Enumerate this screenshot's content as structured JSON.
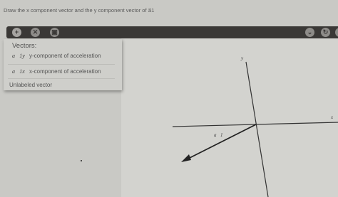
{
  "instruction": "Draw the x component vector and the y component vector of a⃗1",
  "toolbar": {
    "add_label": "+",
    "delete_label": "✕",
    "trash_label": "▣",
    "right_buttons": [
      "⌄",
      "↻",
      "?"
    ]
  },
  "vectors_panel": {
    "title": "Vectors:",
    "items": [
      {
        "symbol": "a⃗1y",
        "label": "y-component of acceleration"
      },
      {
        "symbol": "a⃗1x",
        "label": "x-component of acceleration"
      }
    ],
    "unlabeled": "Unlabeled vector"
  },
  "graph": {
    "x_axis_label": "x",
    "y_axis_label": "y",
    "vector_label": "a⃗1"
  }
}
